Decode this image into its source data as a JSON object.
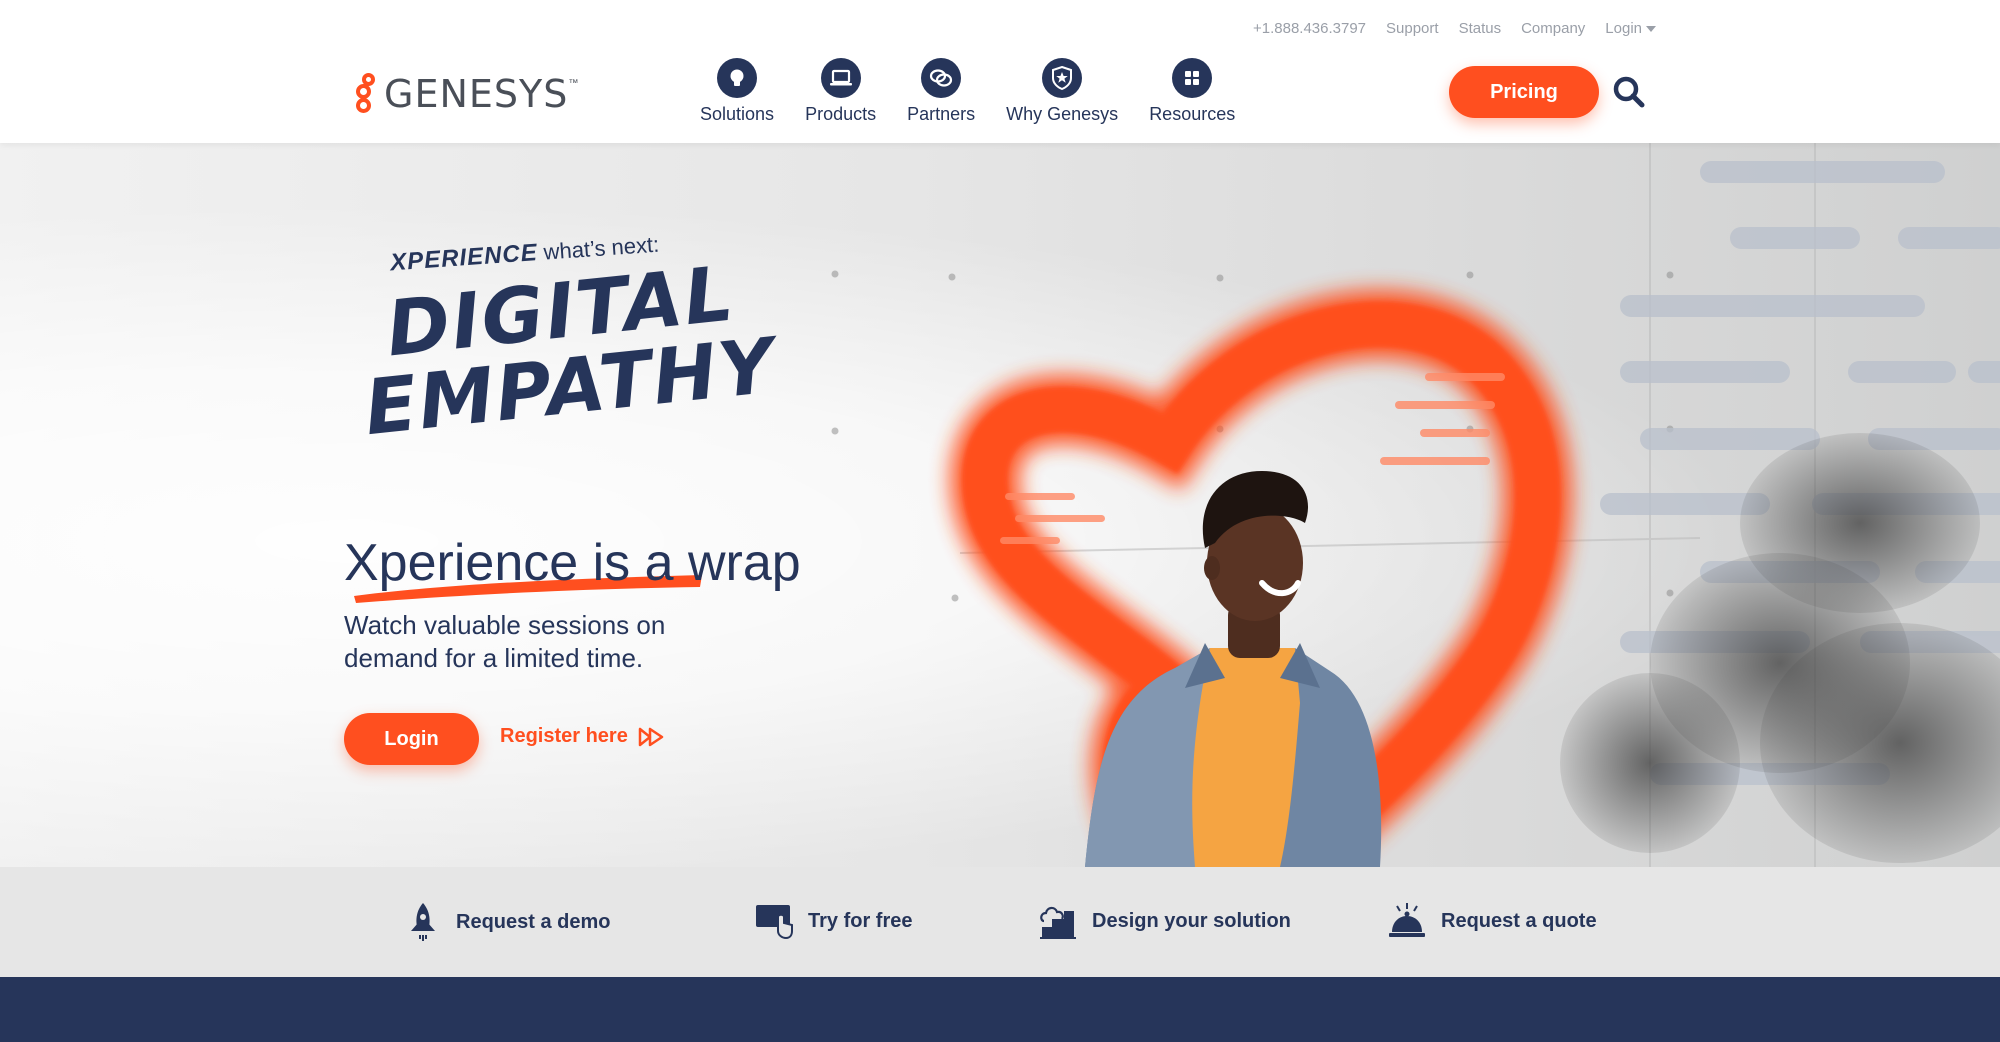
{
  "utility_nav": {
    "phone": "+1.888.436.3797",
    "support": "Support",
    "status": "Status",
    "company": "Company",
    "login": "Login"
  },
  "brand": {
    "name": "GENESYS",
    "tm": "™"
  },
  "main_nav": [
    {
      "label": "Solutions",
      "icon": "lightbulb-icon"
    },
    {
      "label": "Products",
      "icon": "laptop-icon"
    },
    {
      "label": "Partners",
      "icon": "linked-rings-icon"
    },
    {
      "label": "Why Genesys",
      "icon": "shield-star-icon"
    },
    {
      "label": "Resources",
      "icon": "grid-icon"
    }
  ],
  "header": {
    "pricing_label": "Pricing",
    "search_icon": "search-icon"
  },
  "hero": {
    "kicker_brand": "XPERIENCE",
    "kicker_text": "what’s next:",
    "title_line1": "DIGITAL",
    "title_line2": "EMPATHY",
    "heading": "Xperience is a wrap",
    "subtext": "Watch valuable sessions on demand for a limited time.",
    "login_label": "Login",
    "register_label": "Register here"
  },
  "quick_links": [
    {
      "label": "Request a demo",
      "icon": "rocket-icon"
    },
    {
      "label": "Try for free",
      "icon": "screen-touch-icon"
    },
    {
      "label": "Design your solution",
      "icon": "cloud-building-icon"
    },
    {
      "label": "Request a quote",
      "icon": "service-bell-icon"
    }
  ],
  "colors": {
    "brand_orange": "#ff4f1f",
    "navy": "#26355a",
    "strip_gray": "#e6e6e6"
  }
}
